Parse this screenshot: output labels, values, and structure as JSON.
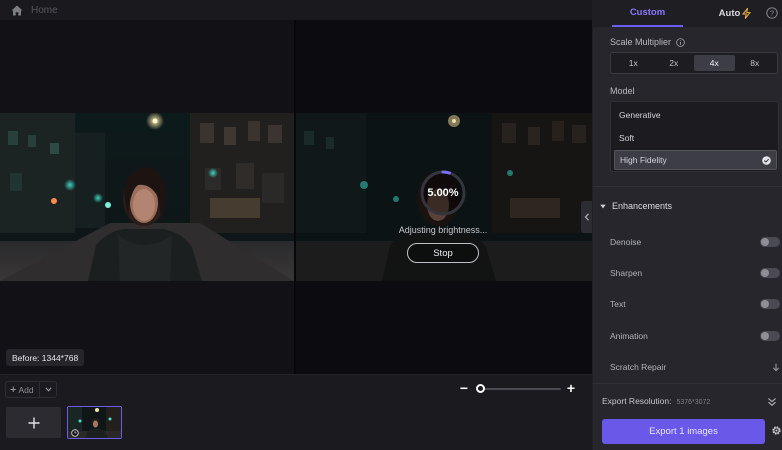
{
  "topbar": {
    "breadcrumb": "Home",
    "home_icon": "home-icon"
  },
  "preview": {
    "progress_percent_text": "5.00%",
    "progress_value": 0.05,
    "status": "Adjusting brightness...",
    "stop_label": "Stop",
    "before_label": "Before: 1344*768"
  },
  "bottom": {
    "add_label": "Add",
    "zoom_level": 0.0
  },
  "panel": {
    "tabs": {
      "custom": "Custom",
      "auto": "Auto"
    },
    "scale": {
      "label": "Scale Multiplier",
      "options": [
        "1x",
        "2x",
        "4x",
        "8x"
      ],
      "selected": "4x"
    },
    "model": {
      "label": "Model",
      "options": [
        "Generative",
        "Soft",
        "High Fidelity"
      ],
      "selected": "High Fidelity"
    },
    "enhancements": {
      "title": "Enhancements",
      "toggles": [
        {
          "label": "Denoise",
          "on": false
        },
        {
          "label": "Sharpen",
          "on": false
        },
        {
          "label": "Text",
          "on": false
        },
        {
          "label": "Animation",
          "on": false
        }
      ],
      "scratch_repair": "Scratch Repair"
    },
    "export": {
      "resolution_label": "Export Resolution:",
      "resolution_value": "5376*3072",
      "button": "Export 1 images"
    }
  },
  "colors": {
    "accent": "#6a59e8",
    "accent_text": "#8a78ff",
    "panel_bg": "#26262c"
  }
}
